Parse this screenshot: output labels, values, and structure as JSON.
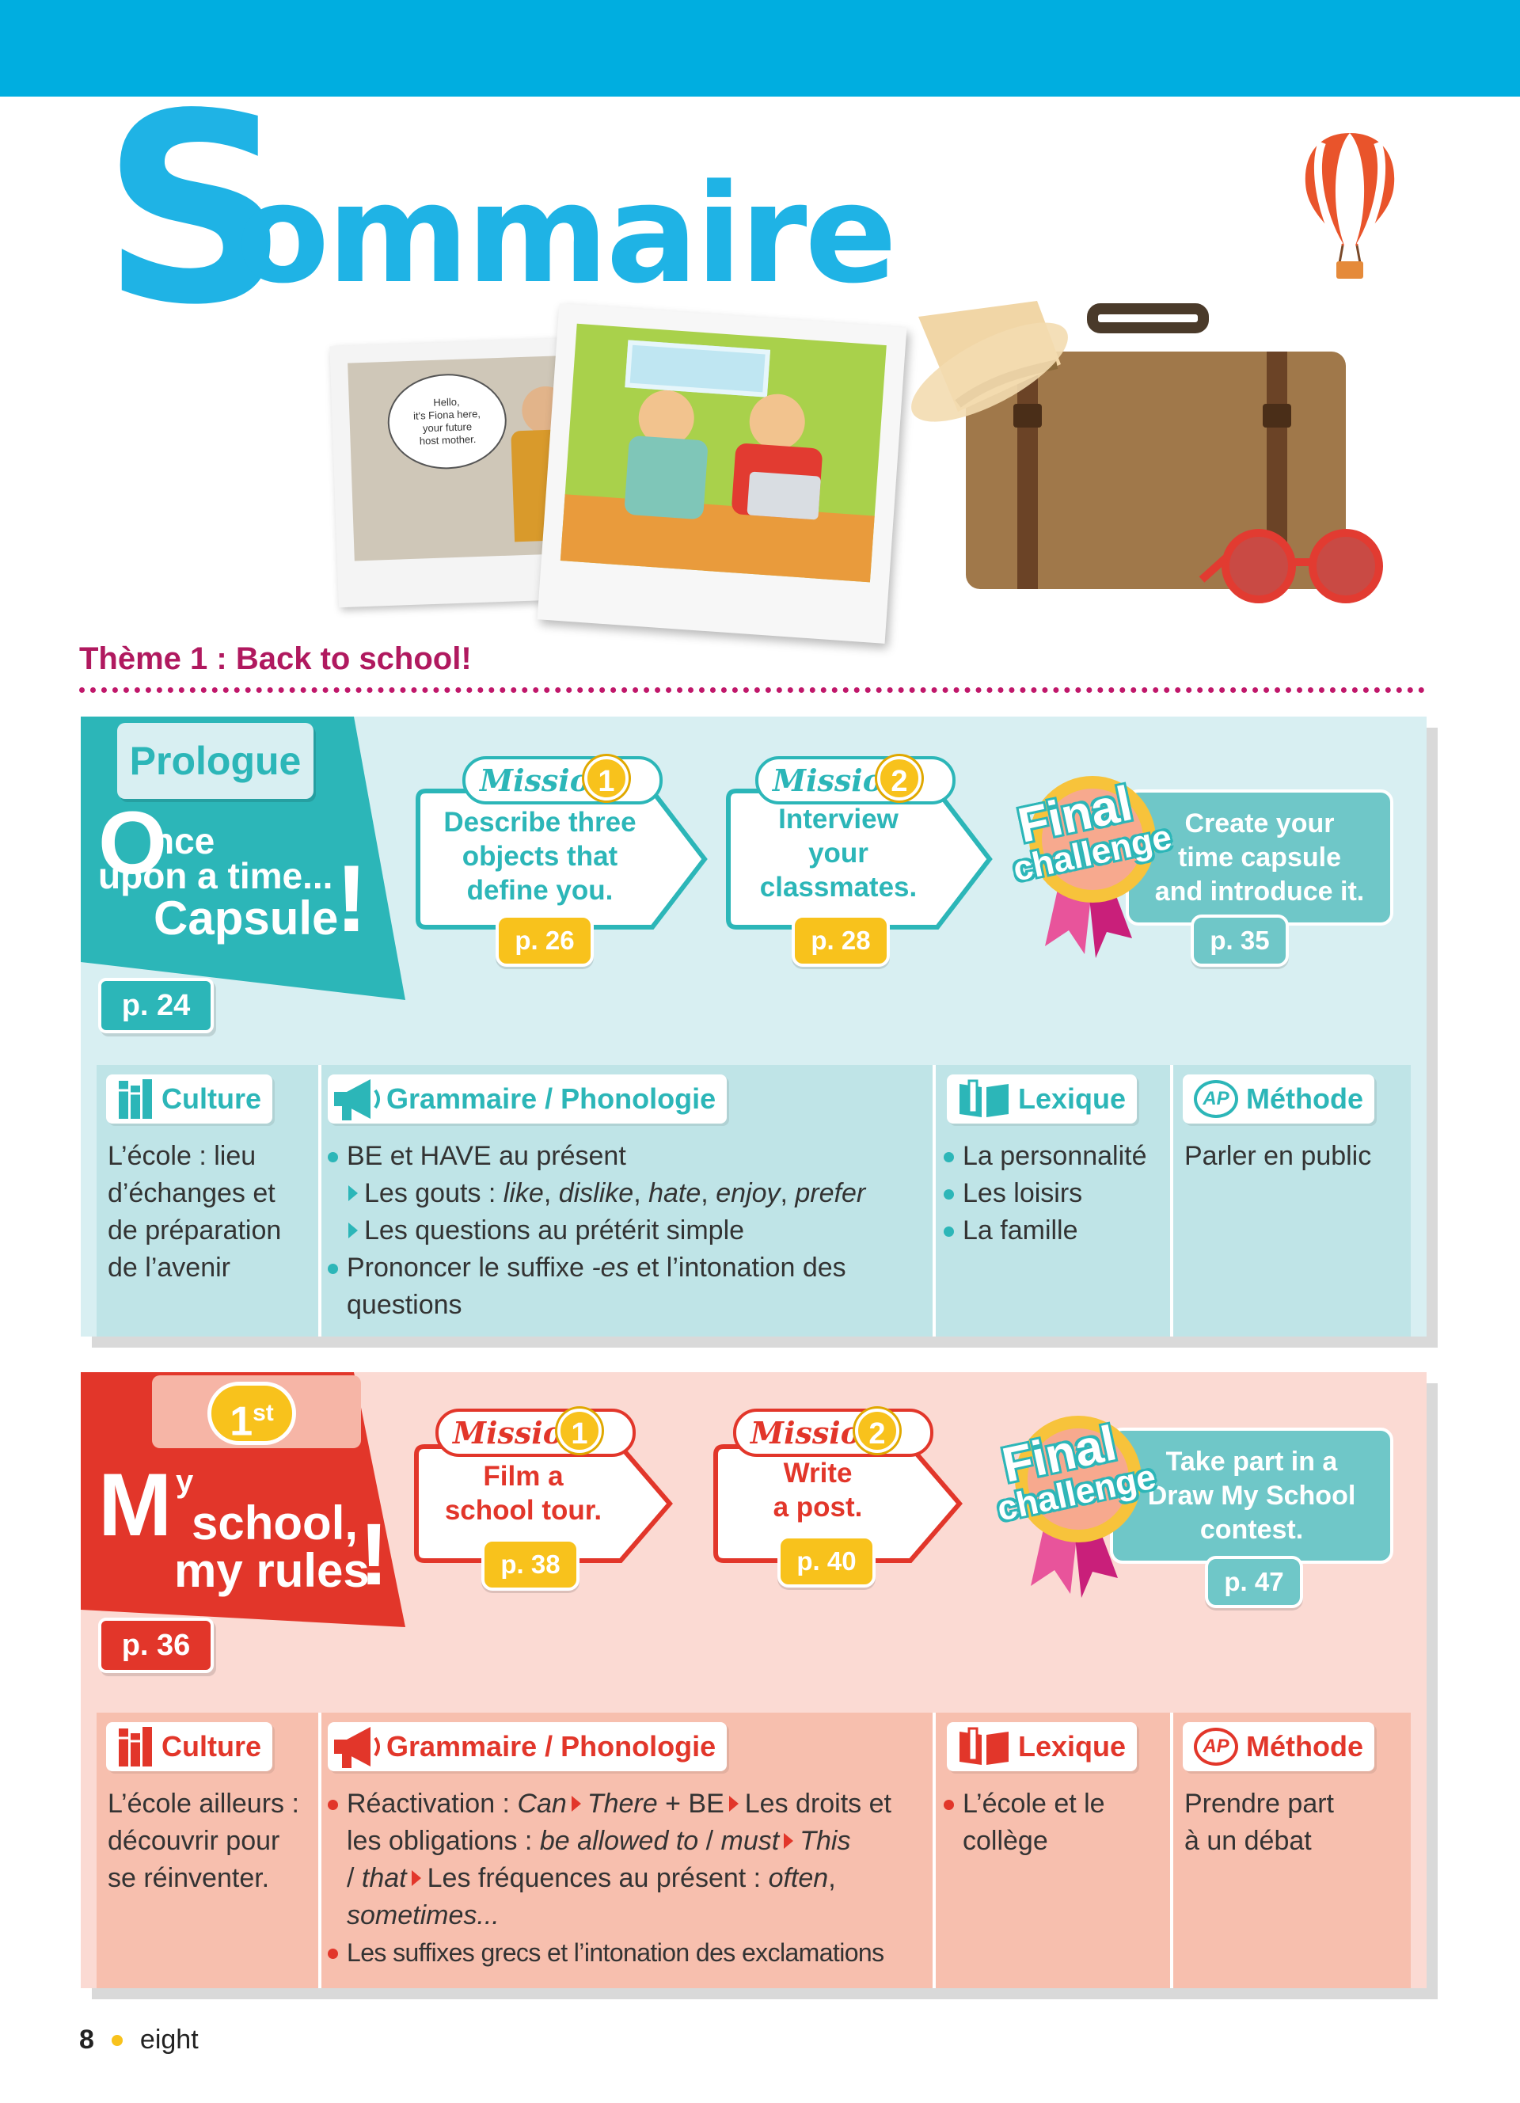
{
  "page": {
    "title_initial": "S",
    "title_rest": "ommaire",
    "footer_number": "8",
    "footer_word": "eight"
  },
  "photo": {
    "speech_lines": [
      "Hello,",
      "it's Fiona here,",
      "your future",
      "host mother."
    ]
  },
  "theme": {
    "title": "Thème 1 : Back to school!"
  },
  "colors": {
    "teal": "#2cb6b8",
    "teal_light": "#d8eff2",
    "red": "#e2362a",
    "red_light": "#fbdad3",
    "yellow": "#f8c21c",
    "magenta": "#b0195f",
    "blue": "#1fb3e5"
  },
  "units": [
    {
      "tag": "Prologue",
      "title_initial": "O",
      "title_line1": "nce",
      "title_line2": "upon a time...",
      "title_line3": "Capsule",
      "title_mark": "!",
      "page": "p. 24",
      "missions": [
        {
          "label": "Mission",
          "number": "1",
          "lines": [
            "Describe three",
            "objects that",
            "define you."
          ],
          "page": "p. 26"
        },
        {
          "label": "Mission",
          "number": "2",
          "lines": [
            "Interview",
            "your",
            "classmates."
          ],
          "page": "p. 28"
        }
      ],
      "final": {
        "label_1": "Final",
        "label_2": "challenge",
        "lines": [
          "Create your",
          "time capsule",
          "and introduce it."
        ],
        "page": "p. 35"
      },
      "columns": {
        "culture": {
          "title": "Culture",
          "text": [
            "L’école : lieu",
            "d’échanges et",
            "de préparation",
            "de l’avenir"
          ]
        },
        "grammaire": {
          "title": "Grammaire / Phonologie",
          "b1": "BE et HAVE au présent",
          "s1_prefix": "Les gouts : ",
          "s1_items": [
            "like",
            "dislike",
            "hate",
            "enjoy",
            "prefer"
          ],
          "s1_sep": ", ",
          "s2": "Les questions au prétérit simple",
          "b2_before": "Prononcer le suffixe ",
          "b2_italic": "-es",
          "b2_after_line1": " et l’intonation des",
          "b2_after_line2": "questions"
        },
        "lexique": {
          "title": "Lexique",
          "items": [
            "La personnalité",
            "Les loisirs",
            "La famille"
          ]
        },
        "methode": {
          "title": "Méthode",
          "icon_text": "AP",
          "text": "Parler en public"
        }
      }
    },
    {
      "tag_number": "1",
      "tag_suffix": "st",
      "title_initial": "M",
      "title_small": "y",
      "title_line2": "school,",
      "title_line3": "my rules",
      "title_mark": "!",
      "page": "p. 36",
      "missions": [
        {
          "label": "Mission",
          "number": "1",
          "lines": [
            "Film a",
            "school tour."
          ],
          "page": "p. 38"
        },
        {
          "label": "Mission",
          "number": "2",
          "lines": [
            "Write",
            "a post."
          ],
          "page": "p. 40"
        }
      ],
      "final": {
        "label_1": "Final",
        "label_2": "challenge",
        "lines": [
          "Take part in a",
          "Draw My School",
          "contest."
        ],
        "page": "p. 47"
      },
      "columns": {
        "culture": {
          "title": "Culture",
          "text": [
            "L’école ailleurs :",
            "découvrir pour",
            "se réinventer."
          ]
        },
        "grammaire": {
          "title": "Grammaire / Phonologie",
          "l1_a": "Réactivation : ",
          "l1_can": "Can",
          "l1_there": "There",
          "l1_be": " + BE",
          "l1_droits": "Les droits et",
          "l2_a": "les obligations : ",
          "l2_allowed": "be allowed to",
          "l2_slash": " / ",
          "l2_must": "must",
          "l2_this": "This",
          "l3_a": "/ ",
          "l3_that": "that",
          "l3_freq": "Les fréquences au présent : ",
          "l3_often": "often",
          "l3_comma": ",",
          "l4": "sometimes...",
          "b2": "Les suffixes grecs et l’intonation des exclamations"
        },
        "lexique": {
          "title": "Lexique",
          "items_line1": "L’école et le",
          "items_line2": "collège"
        },
        "methode": {
          "title": "Méthode",
          "icon_text": "AP",
          "text": [
            "Prendre part",
            "à un débat"
          ]
        }
      }
    }
  ]
}
